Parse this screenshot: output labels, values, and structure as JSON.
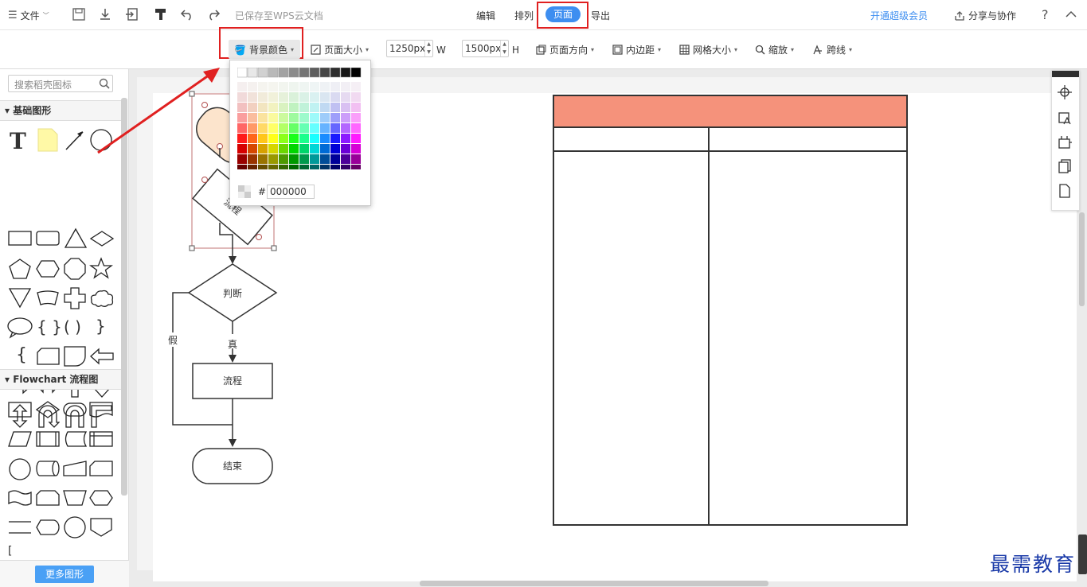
{
  "topbar": {
    "file_label": "文件",
    "save_status": "已保存至WPS云文档",
    "tabs": [
      "编辑",
      "排列",
      "页面",
      "导出"
    ],
    "active_tab": "页面",
    "vip_label": "开通超级会员",
    "share_label": "分享与协作",
    "help_label": "?",
    "accent_color": "#3d8ef0"
  },
  "toolbar": {
    "bg_color_label": "背景颜色",
    "page_size_label": "页面大小",
    "width_value": "1250px",
    "width_unit": "W",
    "height_value": "1500px",
    "height_unit": "H",
    "orientation_label": "页面方向",
    "padding_label": "内边距",
    "grid_label": "网格大小",
    "zoom_label": "缩放",
    "jumpline_label": "跨线"
  },
  "color_popup": {
    "hash": "#",
    "hex_value": "000000"
  },
  "sidebar": {
    "search_placeholder": "搜索稻壳图标",
    "section_basic": "基础图形",
    "section_flowchart": "Flowchart 流程图",
    "more_shapes_label": "更多图形"
  },
  "flowchart": {
    "shape1_label": "开",
    "shape2_label": "流程",
    "decision_label": "判断",
    "false_label": "假",
    "true_label": "真",
    "process_label": "流程",
    "end_label": "结束"
  },
  "table": {
    "header_color": "#f5927b"
  },
  "watermark": "最需教育"
}
